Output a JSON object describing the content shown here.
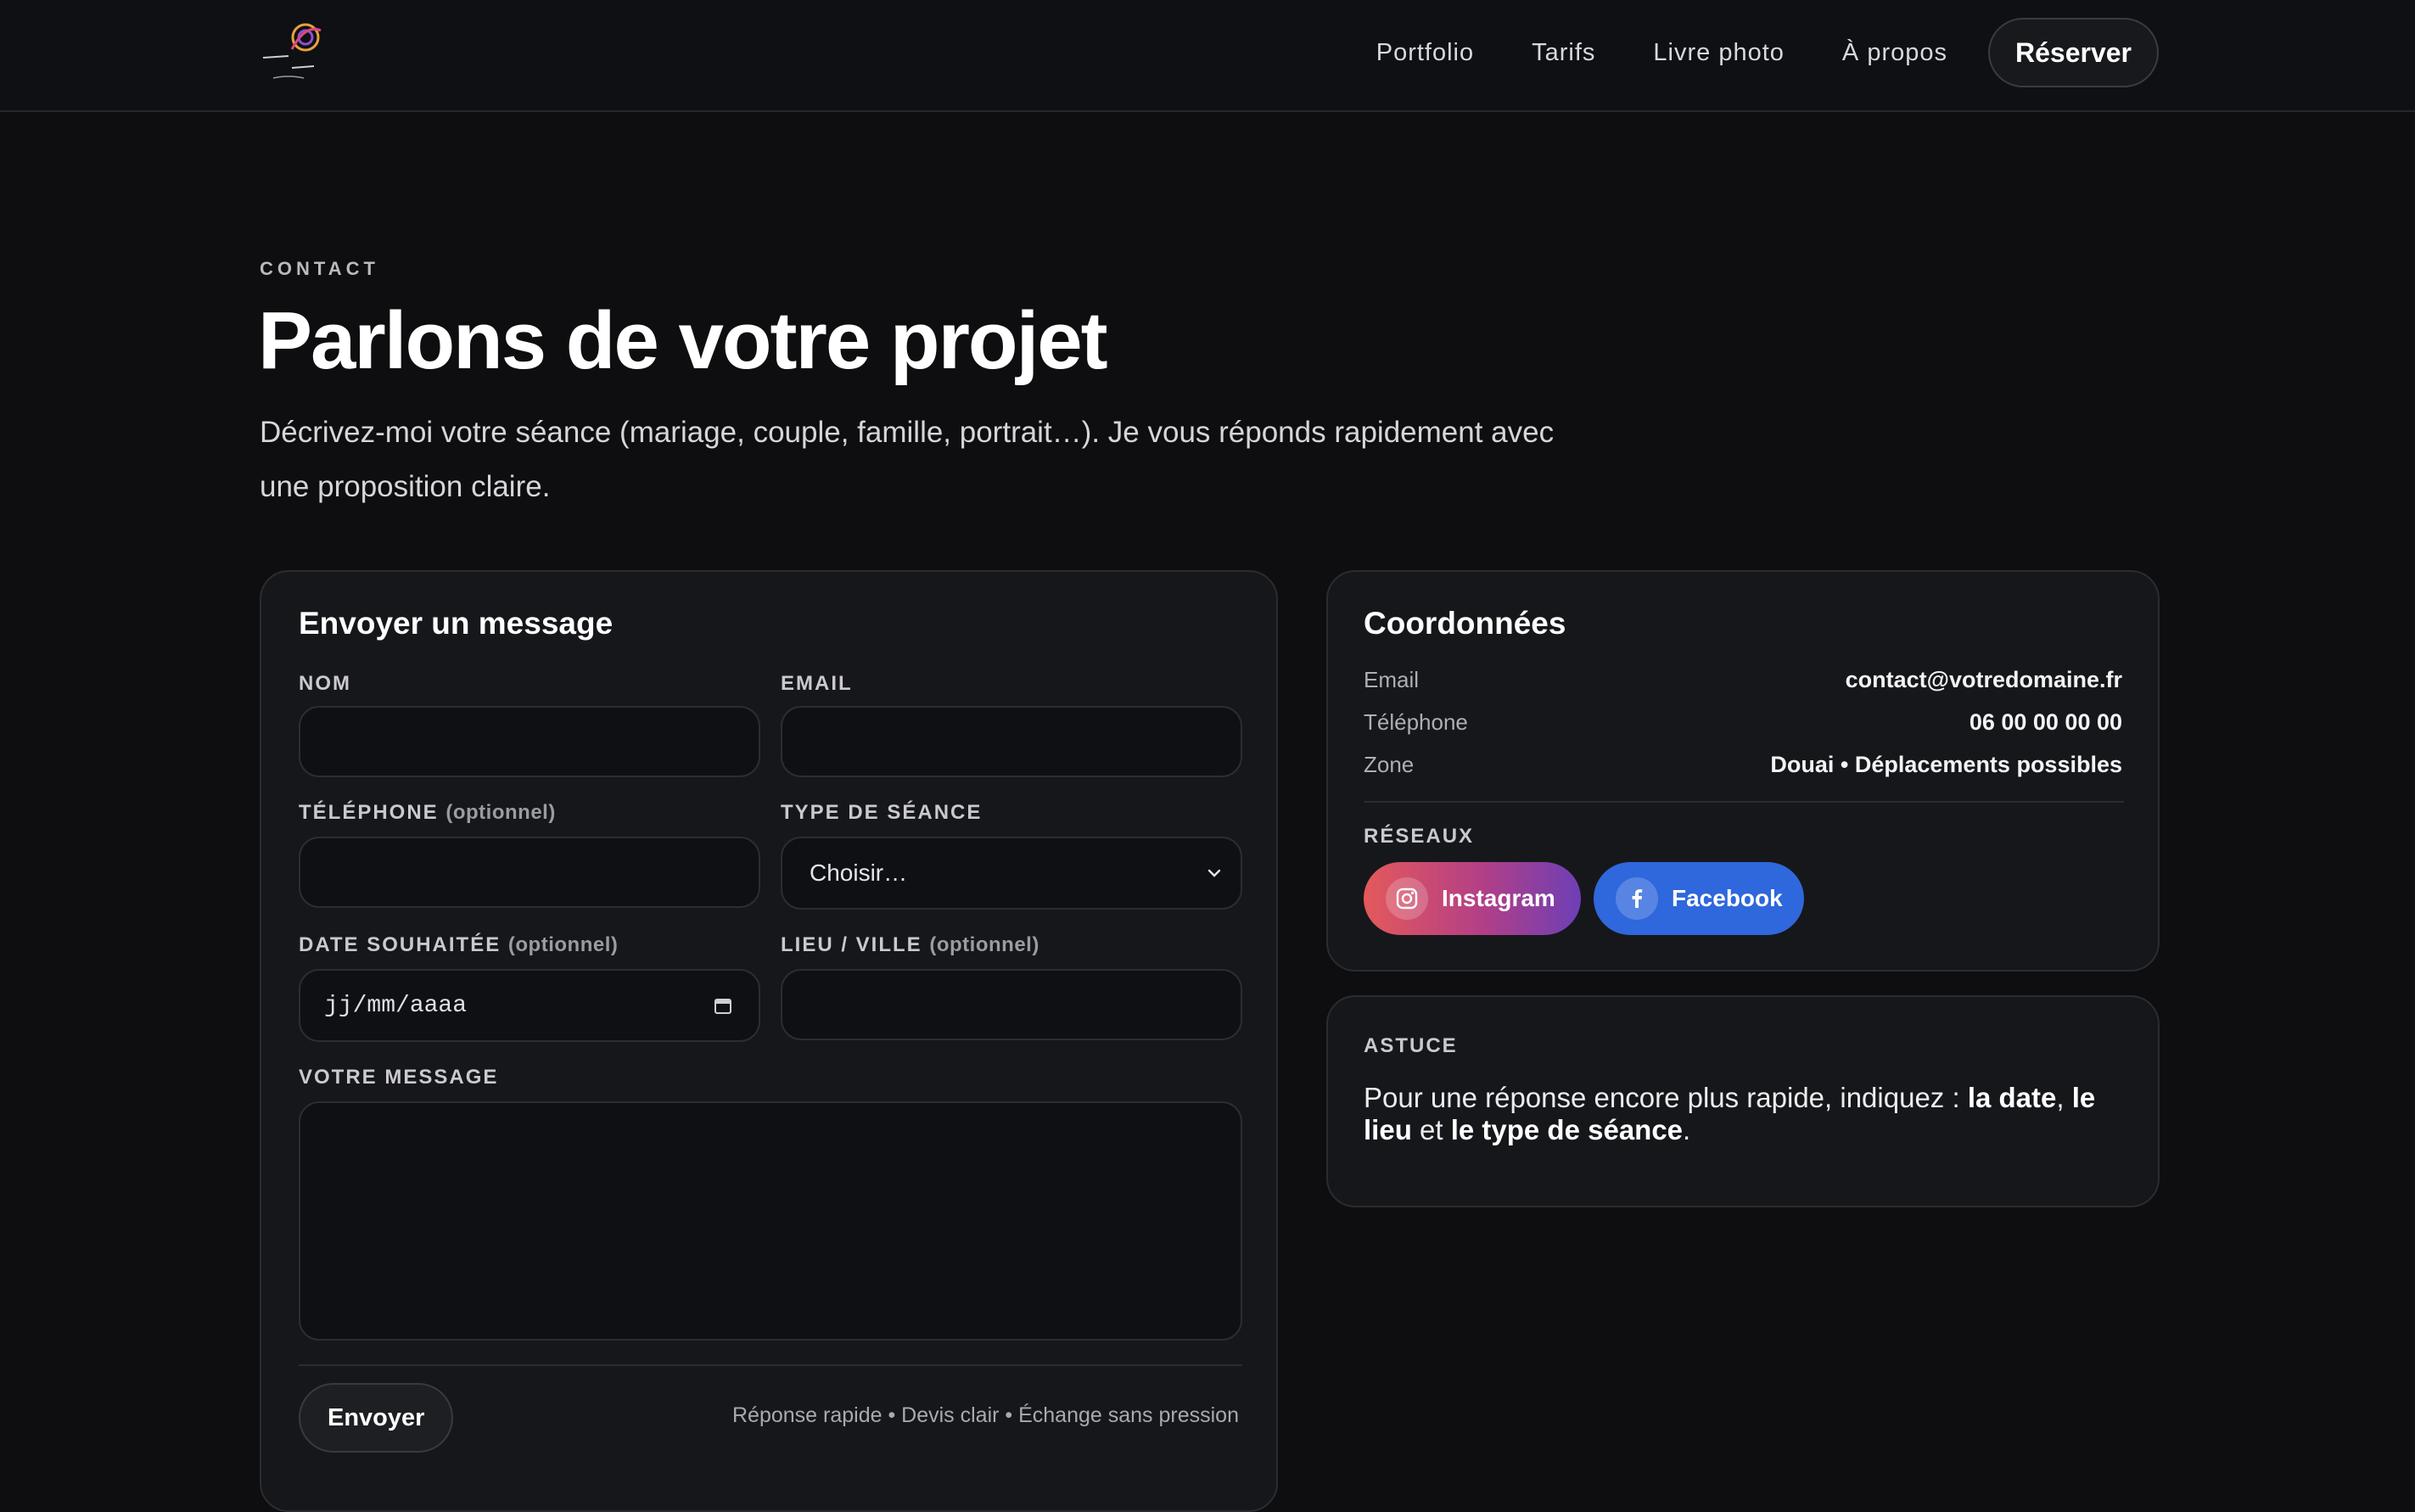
{
  "header": {
    "nav": [
      "Portfolio",
      "Tarifs",
      "Livre photo",
      "À propos"
    ],
    "cta": "Réserver"
  },
  "hero": {
    "eyebrow": "CONTACT",
    "title": "Parlons de votre projet",
    "intro": "Décrivez-moi votre séance (mariage, couple, famille, portrait…). Je vous réponds rapidement avec une proposition claire."
  },
  "form": {
    "title": "Envoyer un message",
    "name_label": "NOM",
    "email_label": "EMAIL",
    "phone_label": "TÉLÉPHONE",
    "optional": "(optionnel)",
    "type_label": "TYPE DE SÉANCE",
    "type_value": "Choisir…",
    "date_label": "DATE SOUHAITÉE",
    "date_placeholder": "jj/mm/aaaa",
    "place_label": "LIEU / VILLE",
    "message_label": "VOTRE MESSAGE",
    "submit": "Envoyer",
    "note": "Réponse rapide • Devis clair • Échange sans pression"
  },
  "info": {
    "title": "Coordonnées",
    "rows": [
      {
        "label": "Email",
        "value": "contact@votredomaine.fr"
      },
      {
        "label": "Téléphone",
        "value": "06 00 00 00 00"
      },
      {
        "label": "Zone",
        "value": "Douai • Déplacements possibles"
      }
    ],
    "social_label": "RÉSEAUX",
    "instagram": "Instagram",
    "facebook": "Facebook"
  },
  "tip": {
    "label": "ASTUCE",
    "t1": "Pour une réponse encore plus rapide, indiquez : ",
    "b1": "la date",
    "t2": ", ",
    "b2": "le lieu",
    "t3": " et ",
    "b3": "le type de séance",
    "t4": "."
  },
  "colors": {
    "background": "#0e0e10",
    "card": "#16171a",
    "instagram_from": "#e4595b",
    "instagram_to": "#6d3fb6",
    "facebook": "#2f67dc"
  },
  "icons": [
    "logo",
    "chevron-down-icon",
    "calendar-icon",
    "instagram-icon",
    "facebook-icon"
  ]
}
